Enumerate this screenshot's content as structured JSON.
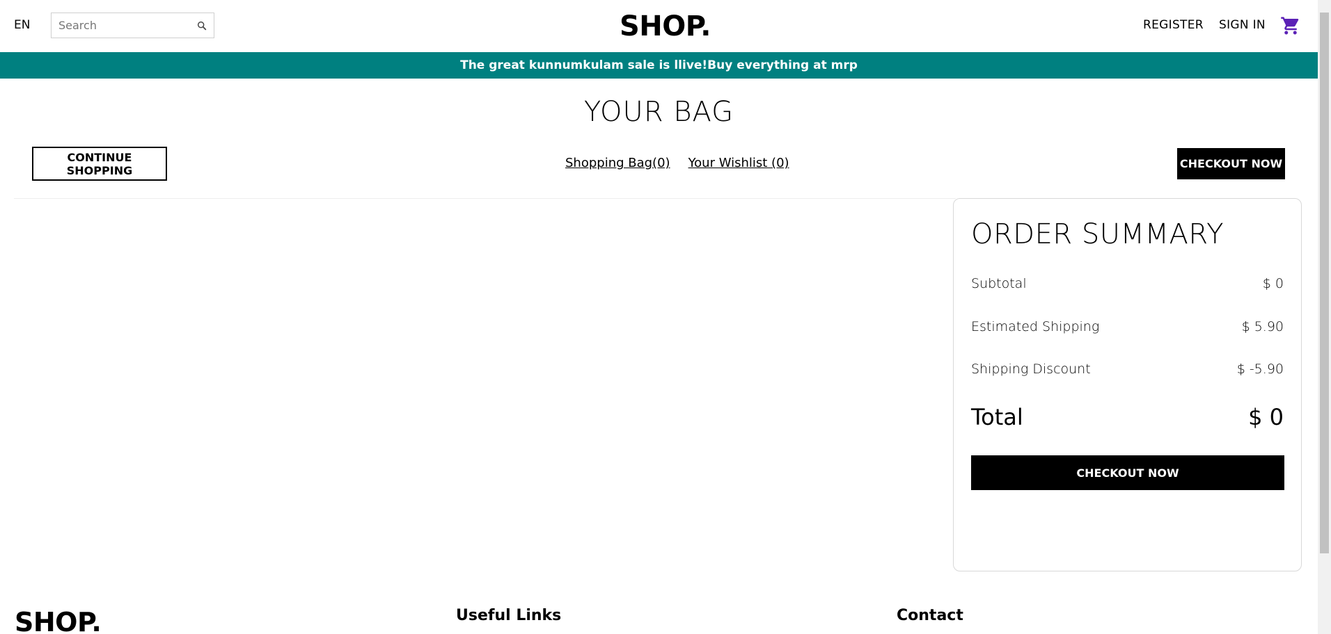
{
  "navbar": {
    "language": "EN",
    "search_placeholder": "Search",
    "logo": "SHOP.",
    "register_label": "REGISTER",
    "signin_label": "SIGN IN",
    "cart_icon": "cart-icon",
    "search_icon": "search-icon"
  },
  "announcement": "The great kunnumkulam sale is llive!Buy everything at mrp",
  "page_title": "YOUR BAG",
  "actions": {
    "continue_label": "CONTINUE SHOPPING",
    "shopping_bag_label": "Shopping Bag(0)",
    "wishlist_label": "Your Wishlist (0)",
    "checkout_label": "CHECKOUT NOW"
  },
  "summary": {
    "title": "ORDER SUMMARY",
    "subtotal_label": "Subtotal",
    "subtotal_value": "$ 0",
    "shipping_label": "Estimated Shipping",
    "shipping_value": "$ 5.90",
    "discount_label": "Shipping Discount",
    "discount_value": "$ -5.90",
    "total_label": "Total",
    "total_value": "$ 0",
    "checkout_label": "CHECKOUT NOW"
  },
  "footer": {
    "logo": "SHOP.",
    "useful_links_heading": "Useful Links",
    "contact_heading": "Contact"
  },
  "colors": {
    "announcement_bg": "#008080",
    "cart_icon": "#5b21b6"
  }
}
